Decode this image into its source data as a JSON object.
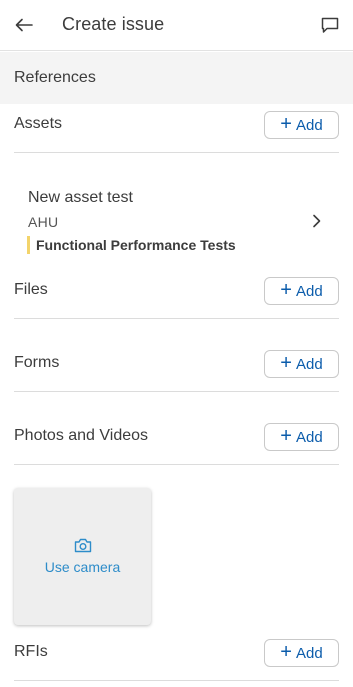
{
  "header": {
    "title": "Create issue",
    "back_icon": "arrow-left-icon",
    "comment_icon": "comment-icon"
  },
  "references": {
    "section_title": "References",
    "add_label": "Add",
    "assets": {
      "label": "Assets",
      "items": [
        {
          "name": "New asset test",
          "type": "AHU",
          "tag": "Functional Performance Tests"
        }
      ]
    },
    "files": {
      "label": "Files"
    },
    "forms": {
      "label": "Forms"
    },
    "photos": {
      "label": "Photos and Videos",
      "camera_label": "Use camera",
      "camera_icon": "camera-icon"
    },
    "rfis": {
      "label": "RFIs"
    }
  },
  "colors": {
    "accent": "#0b5cab",
    "camera_accent": "#2d8cc9",
    "tag_bar": "#f3d46b",
    "band_bg": "#f4f4f4"
  }
}
